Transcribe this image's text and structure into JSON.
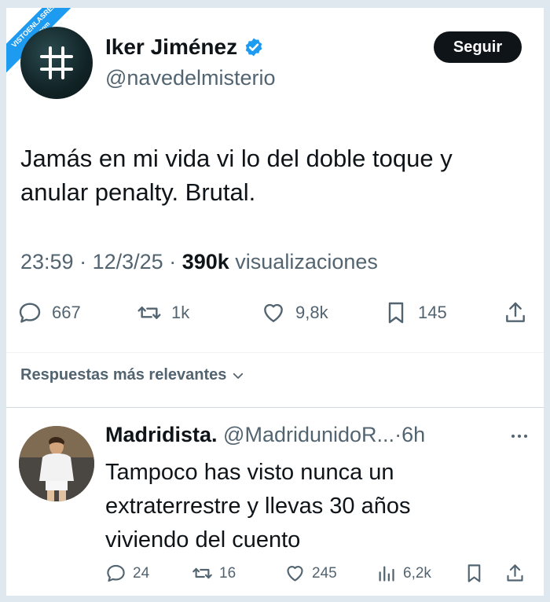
{
  "watermark": {
    "line1": "VISTOENLASREDES",
    "line2": ".com"
  },
  "tweet": {
    "author_name": "Iker Jiménez",
    "author_handle": "@navedelmisterio",
    "follow_label": "Seguir",
    "text_line1": "Jamás en mi vida vi lo del doble toque y",
    "text_line2": "anular penalty. Brutal.",
    "time": "23:59",
    "date": "12/3/25",
    "views_count": "390k",
    "views_label": "visualizaciones",
    "replies": "667",
    "retweets": "1k",
    "likes": "9,8k",
    "bookmarks": "145"
  },
  "relevance_label": "Respuestas más relevantes",
  "reply": {
    "author_name": "Madridista.",
    "author_handle": "@MadridunidoR...",
    "age": "6h",
    "text_line1": "Tampoco has visto nunca un",
    "text_line2": "extraterrestre y llevas 30 años",
    "text_line3": "viviendo del cuento",
    "replies": "24",
    "retweets": "16",
    "likes": "245",
    "views": "6,2k"
  },
  "colors": {
    "accent": "#1d9bf0",
    "text": "#0f1419",
    "muted": "#536471"
  },
  "icons": [
    "hashtag-logo-icon",
    "verified-icon",
    "reply-icon",
    "retweet-icon",
    "like-icon",
    "bookmark-icon",
    "share-icon",
    "chevron-down-icon",
    "more-icon",
    "views-icon"
  ]
}
